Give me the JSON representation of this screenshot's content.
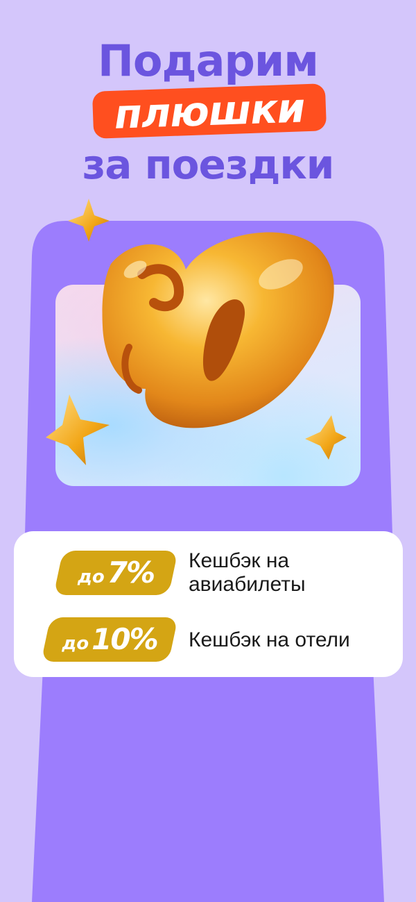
{
  "headline": {
    "line1": "Подарим",
    "highlight": "плюшки",
    "line3": "за поездки"
  },
  "benefits": [
    {
      "prefix": "до",
      "value": "7%",
      "text": "Кешбэк на авиабилеты"
    },
    {
      "prefix": "до",
      "value": "10%",
      "text": "Кешбэк на отели"
    }
  ],
  "colors": {
    "background": "#d4c6fb",
    "stand": "#9c7dfd",
    "headline": "#6b55df",
    "highlight_pill": "#ff4f1f",
    "badge": "#d4a514",
    "gold": "#f2a617"
  },
  "icons": [
    "sparkle-star-icon",
    "gold-heart-logo"
  ]
}
